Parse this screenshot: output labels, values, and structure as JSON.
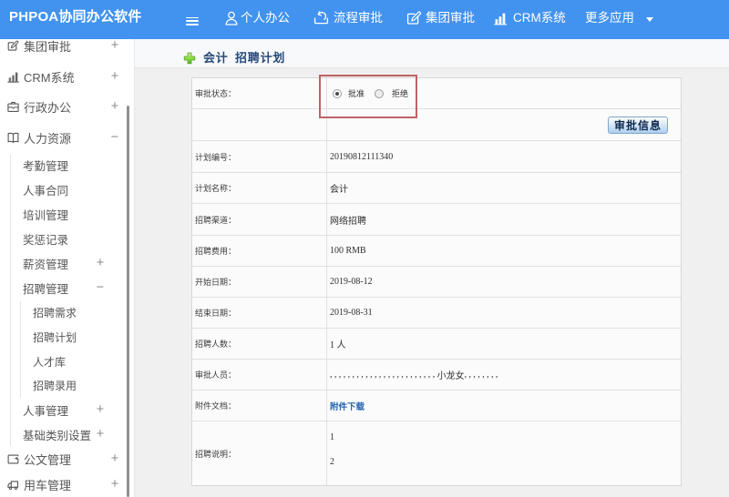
{
  "header": {
    "logo": "PHPOA协同办公软件",
    "nav": [
      {
        "label": "个人办公",
        "icon": "user-icon"
      },
      {
        "label": "流程审批",
        "icon": "process-icon"
      },
      {
        "label": "集团审批",
        "icon": "edit-icon"
      },
      {
        "label": "CRM系统",
        "icon": "bar-chart-icon"
      },
      {
        "label": "更多应用",
        "icon": "caret-down-icon"
      }
    ]
  },
  "sidebar": {
    "items": [
      {
        "label": "集团审批",
        "level": 1,
        "icon": "edit-icon",
        "expander": "+"
      },
      {
        "label": "CRM系统",
        "level": 1,
        "icon": "bar-chart-icon",
        "expander": "+"
      },
      {
        "label": "行政办公",
        "level": 1,
        "icon": "briefcase-icon",
        "expander": "+"
      },
      {
        "label": "人力资源",
        "level": 1,
        "icon": "book-icon",
        "expander": "−"
      },
      {
        "label": "考勤管理",
        "level": 2
      },
      {
        "label": "人事合同",
        "level": 2
      },
      {
        "label": "培训管理",
        "level": 2
      },
      {
        "label": "奖惩记录",
        "level": 2
      },
      {
        "label": "薪资管理",
        "level": 2,
        "expander": "+"
      },
      {
        "label": "招聘管理",
        "level": 2,
        "expander": "−"
      },
      {
        "label": "招聘需求",
        "level": 3
      },
      {
        "label": "招聘计划",
        "level": 3
      },
      {
        "label": "人才库",
        "level": 3
      },
      {
        "label": "招聘录用",
        "level": 3
      },
      {
        "label": "人事管理",
        "level": 2,
        "expander": "+"
      },
      {
        "label": "基础类别设置",
        "level": 2,
        "expander": "+"
      },
      {
        "label": "公文管理",
        "level": 1,
        "icon": "document-icon",
        "expander": "+"
      },
      {
        "label": "用车管理",
        "level": 1,
        "icon": "truck-icon",
        "expander": "+"
      }
    ]
  },
  "main": {
    "title": "会计 招聘计划",
    "form": {
      "status_label": "审批状态：",
      "radio_approve": "批准",
      "radio_reject": "拒绝",
      "radio_selected": "批准",
      "approve_button": "审批信息",
      "rows": [
        {
          "label": "计划编号：",
          "value": "20190812111340"
        },
        {
          "label": "计划名称：",
          "value": "会计"
        },
        {
          "label": "招聘渠道：",
          "value": "网络招聘"
        },
        {
          "label": "招聘费用：",
          "value": "100 RMB"
        },
        {
          "label": "开始日期：",
          "value": "2019-08-12"
        },
        {
          "label": "结束日期：",
          "value": "2019-08-31"
        },
        {
          "label": "招聘人数：",
          "value": "1 人"
        },
        {
          "label": "审批人员：",
          "parts": {
            "before": ",,,,,,,,,,,,,,,,,,,,,,,,",
            "name": "小龙女",
            "after": ",,,,,,,,"
          }
        },
        {
          "label": "附件文档：",
          "link": "附件下载"
        },
        {
          "label": "招聘说明：",
          "lines": [
            "1",
            "2"
          ]
        }
      ]
    }
  },
  "colors": {
    "navbar_blue": "#4293f0",
    "highlight_red": "#bd6364",
    "link_blue": "#2565ae",
    "title_navy": "#254878"
  }
}
